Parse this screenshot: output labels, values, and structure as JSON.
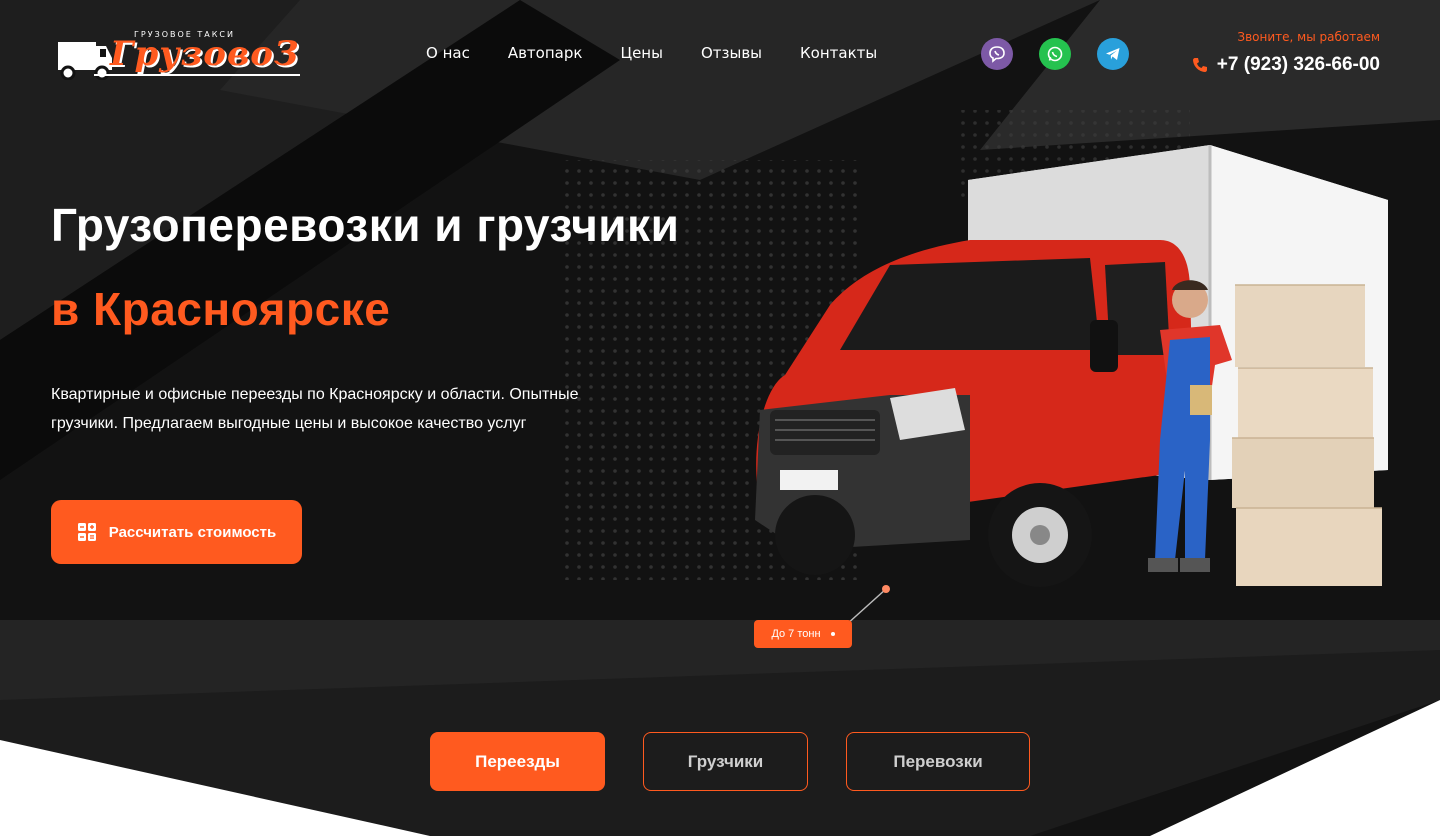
{
  "header": {
    "logo": {
      "subtitle": "ГРУЗОВОЕ ТАКСИ",
      "title": "ГрузовоЗ"
    },
    "nav": [
      {
        "label": "О нас"
      },
      {
        "label": "Автопарк"
      },
      {
        "label": "Цены"
      },
      {
        "label": "Отзывы"
      },
      {
        "label": "Контакты"
      }
    ],
    "social": [
      {
        "icon": "viber-icon",
        "color": "#7d59a6"
      },
      {
        "icon": "whatsapp-icon",
        "color": "#25c24f"
      },
      {
        "icon": "telegram-icon",
        "color": "#29a0db"
      }
    ],
    "contact": {
      "hint": "Звоните, мы работаем",
      "phone": "+7 (923) 326-66-00",
      "icon": "phone-icon"
    }
  },
  "hero": {
    "title_line1": "Грузоперевозки и грузчики",
    "title_line2": "в Красноярске",
    "description": "Квартирные и офисные переезды по Красноярску и области. Опытные грузчики. Предлагаем выгодные цены и высокое качество услуг",
    "cta": {
      "label": "Рассчитать стоимость",
      "icon": "calculator-icon"
    },
    "tag": {
      "label": "До 7 тонн"
    }
  },
  "tabs": [
    {
      "label": "Переезды",
      "active": true
    },
    {
      "label": "Грузчики",
      "active": false
    },
    {
      "label": "Перевозки",
      "active": false
    }
  ],
  "colors": {
    "accent": "#ff5a1f",
    "dark": "#141414"
  }
}
